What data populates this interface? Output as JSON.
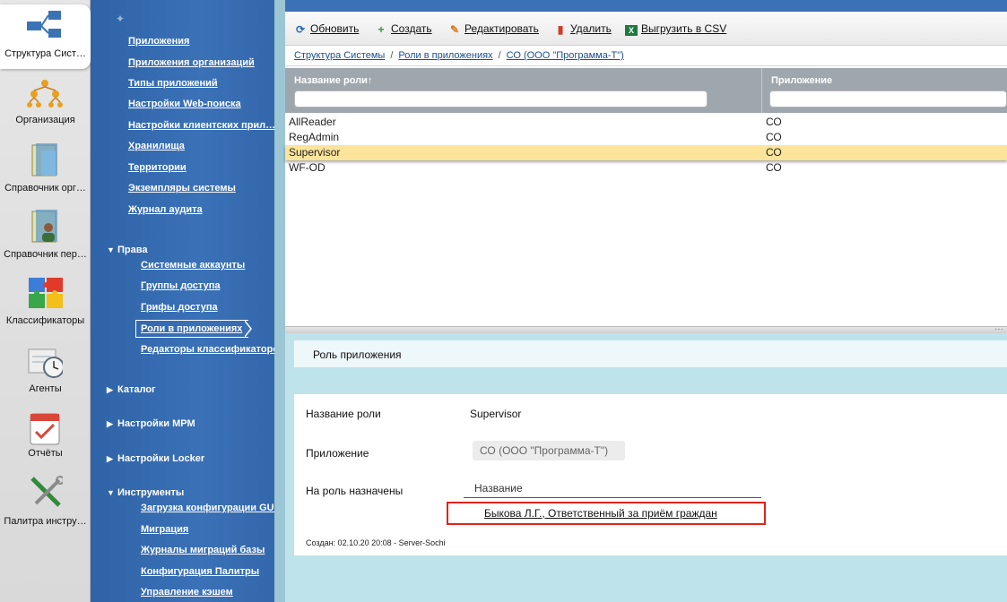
{
  "rail": {
    "items": [
      {
        "label": "Структура Сист…",
        "icon": "system-structure-icon"
      },
      {
        "label": "Организация",
        "icon": "organization-icon"
      },
      {
        "label": "Справочник орг…",
        "icon": "org-directory-icon"
      },
      {
        "label": "Справочник пер…",
        "icon": "person-directory-icon"
      },
      {
        "label": "Классификаторы",
        "icon": "puzzle-icon"
      },
      {
        "label": "Агенты",
        "icon": "clock-icon"
      },
      {
        "label": "Отчёты",
        "icon": "report-icon"
      },
      {
        "label": "Палитра инстру…",
        "icon": "tools-icon"
      }
    ]
  },
  "nav": {
    "links_top": [
      "Приложения",
      "Приложения организаций",
      "Типы приложений",
      "Настройки Web-поиска",
      "Настройки клиентских прил…",
      "Хранилища",
      "Территории",
      "Экземпляры системы",
      "Журнал аудита"
    ],
    "group_rights": "Права",
    "rights_links": [
      "Системные аккаунты",
      "Группы доступа",
      "Грифы доступа",
      "Роли в приложениях",
      "Редакторы классификаторов"
    ],
    "group_catalog": "Каталог",
    "group_mpm": "Настройки МРМ",
    "group_locker": "Настройки Locker",
    "group_tools": "Инструменты",
    "tools_links": [
      "Загрузка конфигурации GUI",
      "Миграция",
      "Журналы миграций базы",
      "Конфигурация Палитры",
      "Управление кэшем"
    ]
  },
  "toolbar": {
    "refresh": "Обновить",
    "create": "Создать",
    "edit": "Редактировать",
    "delete": "Удалить",
    "export": "Выгрузить в CSV"
  },
  "breadcrumb": [
    "Структура Системы",
    "Роли в приложениях",
    "СО (ООО \"Программа-Т\")"
  ],
  "grid": {
    "col1": "Название роли↑",
    "col2": "Приложение",
    "rows": [
      {
        "name": "AllReader",
        "app": "СО"
      },
      {
        "name": "RegAdmin",
        "app": "СО"
      },
      {
        "name": "Supervisor",
        "app": "СО"
      },
      {
        "name": "WF-OD",
        "app": "СО"
      }
    ]
  },
  "detail": {
    "title": "Роль приложения",
    "role_name_label": "Название роли",
    "role_name_value": "Supervisor",
    "app_label": "Приложение",
    "app_value": "СО (ООО \"Программа-Т\")",
    "assigned_label": "На роль назначены",
    "assigned_header": "Название",
    "assigned_item": "Быкова Л.Г., Ответственный за приём граждан",
    "created": "Создан: 02.10.20 20:08 - Server-Sochi"
  }
}
